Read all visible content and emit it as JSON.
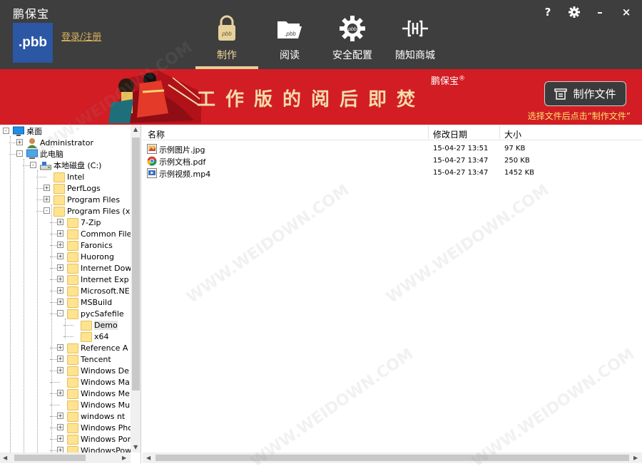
{
  "app": {
    "title": "鹏保宝",
    "logo_text": ".pbb",
    "login_link": "登录/注册"
  },
  "nav": {
    "tabs": [
      {
        "label": "制作",
        "icon": "lock-pbb-icon",
        "active": true
      },
      {
        "label": "阅读",
        "icon": "folder-open-pbb-icon",
        "active": false
      },
      {
        "label": "安全配置",
        "icon": "gear-pbb-icon",
        "active": false
      },
      {
        "label": "随知商城",
        "icon": "shop-logo-icon",
        "active": false
      }
    ]
  },
  "window_controls": {
    "help": "?",
    "settings": "gear-icon",
    "minimize": "–",
    "close": "×"
  },
  "banner": {
    "slogan": "工作版的阅后即焚",
    "brand": "鹏保宝",
    "brand_mark": "®",
    "make_file_button": "制作文件",
    "hint": "选择文件后点击“制作文件”"
  },
  "tree": {
    "items": [
      {
        "label": "桌面",
        "icon": "desktop-icon",
        "level": 0,
        "expander": "-"
      },
      {
        "label": "Administrator",
        "icon": "user-icon",
        "level": 1,
        "expander": "+"
      },
      {
        "label": "此电脑",
        "icon": "computer-icon",
        "level": 1,
        "expander": "-"
      },
      {
        "label": "本地磁盘 (C:)",
        "icon": "drive-icon",
        "level": 2,
        "expander": "-"
      },
      {
        "label": "Intel",
        "icon": "folder-icon",
        "level": 3,
        "expander": ""
      },
      {
        "label": "PerfLogs",
        "icon": "folder-icon",
        "level": 3,
        "expander": "+"
      },
      {
        "label": "Program Files",
        "icon": "folder-icon",
        "level": 3,
        "expander": "+"
      },
      {
        "label": "Program Files (x",
        "icon": "folder-icon",
        "level": 3,
        "expander": "-"
      },
      {
        "label": "7-Zip",
        "icon": "folder-icon",
        "level": 4,
        "expander": "+"
      },
      {
        "label": "Common File",
        "icon": "folder-icon",
        "level": 4,
        "expander": "+"
      },
      {
        "label": "Faronics",
        "icon": "folder-icon",
        "level": 4,
        "expander": "+"
      },
      {
        "label": "Huorong",
        "icon": "folder-icon",
        "level": 4,
        "expander": "+"
      },
      {
        "label": "Internet Dow",
        "icon": "folder-icon",
        "level": 4,
        "expander": "+"
      },
      {
        "label": "Internet Exp",
        "icon": "folder-icon",
        "level": 4,
        "expander": "+"
      },
      {
        "label": "Microsoft.NE",
        "icon": "folder-icon",
        "level": 4,
        "expander": "+"
      },
      {
        "label": "MSBuild",
        "icon": "folder-icon",
        "level": 4,
        "expander": "+"
      },
      {
        "label": "pycSafefile",
        "icon": "folder-icon",
        "level": 4,
        "expander": "-"
      },
      {
        "label": "Demo",
        "icon": "folder-icon",
        "level": 5,
        "expander": "",
        "selected": true
      },
      {
        "label": "x64",
        "icon": "folder-icon",
        "level": 5,
        "expander": ""
      },
      {
        "label": "Reference A",
        "icon": "folder-icon",
        "level": 4,
        "expander": "+"
      },
      {
        "label": "Tencent",
        "icon": "folder-icon",
        "level": 4,
        "expander": "+"
      },
      {
        "label": "Windows De",
        "icon": "folder-icon",
        "level": 4,
        "expander": "+"
      },
      {
        "label": "Windows Ma",
        "icon": "folder-icon",
        "level": 4,
        "expander": ""
      },
      {
        "label": "Windows Me",
        "icon": "folder-icon",
        "level": 4,
        "expander": "+"
      },
      {
        "label": "Windows Mu",
        "icon": "folder-icon",
        "level": 4,
        "expander": ""
      },
      {
        "label": "windows nt",
        "icon": "folder-icon",
        "level": 4,
        "expander": "+"
      },
      {
        "label": "Windows Pho",
        "icon": "folder-icon",
        "level": 4,
        "expander": "+"
      },
      {
        "label": "Windows Por",
        "icon": "folder-icon",
        "level": 4,
        "expander": "+"
      },
      {
        "label": "WindowsPow",
        "icon": "folder-icon",
        "level": 4,
        "expander": "+"
      }
    ]
  },
  "filelist": {
    "columns": [
      "名称",
      "修改日期",
      "大小"
    ],
    "rows": [
      {
        "name": "示例图片.jpg",
        "date": "15-04-27 13:51",
        "size": "97 KB",
        "icon": "image-file-icon"
      },
      {
        "name": "示例文档.pdf",
        "date": "15-04-27 13:47",
        "size": "250 KB",
        "icon": "chrome-pdf-icon"
      },
      {
        "name": "示例视频.mp4",
        "date": "15-04-27 13:47",
        "size": "1452 KB",
        "icon": "video-file-icon"
      }
    ]
  },
  "watermark": "WWW.WEIDOWN.COM",
  "colors": {
    "header_bg": "#3e3e3e",
    "banner_bg": "#d21d24",
    "active_tab": "#e6cf98",
    "logo_bg": "#2b57a4",
    "link": "#d7b25a",
    "hint": "#ffe16b"
  }
}
